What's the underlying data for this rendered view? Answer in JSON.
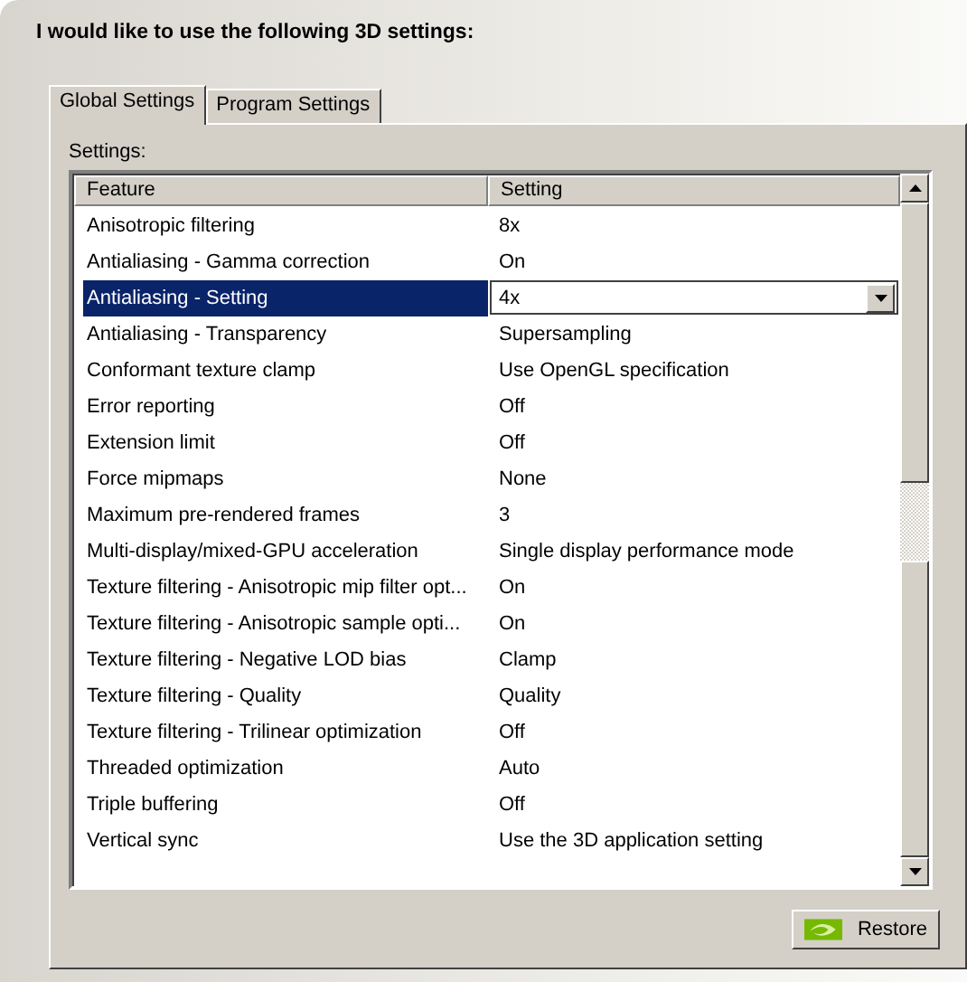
{
  "heading": "I would like to use the following 3D settings:",
  "tabs": [
    {
      "label": "Global Settings",
      "selected": true
    },
    {
      "label": "Program Settings",
      "selected": false
    }
  ],
  "settings_label": "Settings:",
  "table": {
    "columns": [
      "Feature",
      "Setting"
    ],
    "rows": [
      {
        "feature": "Anisotropic filtering",
        "setting": "8x",
        "selected": false
      },
      {
        "feature": "Antialiasing - Gamma correction",
        "setting": "On",
        "selected": false
      },
      {
        "feature": "Antialiasing - Setting",
        "setting": "4x",
        "selected": true
      },
      {
        "feature": "Antialiasing - Transparency",
        "setting": "Supersampling",
        "selected": false
      },
      {
        "feature": "Conformant texture clamp",
        "setting": "Use OpenGL specification",
        "selected": false
      },
      {
        "feature": "Error reporting",
        "setting": "Off",
        "selected": false
      },
      {
        "feature": "Extension limit",
        "setting": "Off",
        "selected": false
      },
      {
        "feature": "Force mipmaps",
        "setting": "None",
        "selected": false
      },
      {
        "feature": "Maximum pre-rendered frames",
        "setting": "3",
        "selected": false
      },
      {
        "feature": "Multi-display/mixed-GPU acceleration",
        "setting": "Single display performance mode",
        "selected": false
      },
      {
        "feature": "Texture filtering - Anisotropic mip filter opt...",
        "setting": "On",
        "selected": false
      },
      {
        "feature": "Texture filtering - Anisotropic sample opti...",
        "setting": "On",
        "selected": false
      },
      {
        "feature": "Texture filtering - Negative LOD bias",
        "setting": "Clamp",
        "selected": false
      },
      {
        "feature": "Texture filtering - Quality",
        "setting": "Quality",
        "selected": false
      },
      {
        "feature": "Texture filtering - Trilinear optimization",
        "setting": "Off",
        "selected": false
      },
      {
        "feature": "Threaded optimization",
        "setting": "Auto",
        "selected": false
      },
      {
        "feature": "Triple buffering",
        "setting": "Off",
        "selected": false
      },
      {
        "feature": "Vertical sync",
        "setting": "Use the 3D application setting",
        "selected": false
      }
    ]
  },
  "restore_button": "Restore"
}
